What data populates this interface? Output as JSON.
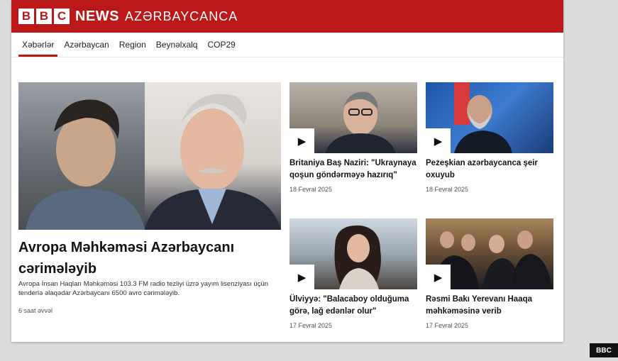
{
  "brand": {
    "blocks": [
      "B",
      "B",
      "C"
    ],
    "news_word": "NEWS",
    "service_word": "AZƏRBAYCANCA",
    "accent_color": "#bb1919"
  },
  "nav": {
    "items": [
      {
        "label": "Xəbərlər",
        "active": true
      },
      {
        "label": "Azərbaycan",
        "active": false
      },
      {
        "label": "Region",
        "active": false
      },
      {
        "label": "Beynəlxalq",
        "active": false
      },
      {
        "label": "COP29",
        "active": false
      }
    ]
  },
  "lead_story": {
    "title": "Avropa Məhkəməsi Azərbaycanı cərimələyib",
    "summary": "Avropa İnsan Haqları Məhkəməsi 103.3 FM radio tezliyi üzrə yayım lisenziyası üçün tenderlə əlaqədar Azərbaycanı 6500 avro cərimələyib.",
    "time": "6 saat əvvəl"
  },
  "cards": [
    {
      "title": "Britaniya Baş Naziri: \"Ukraynaya qoşun göndərməyə hazırıq\"",
      "date": "18 Fevral 2025",
      "icon": "play-icon"
    },
    {
      "title": "Pezeşkian azərbaycanca şeir oxuyub",
      "date": "18 Fevral 2025",
      "icon": "play-icon"
    },
    {
      "title": "Ülviyyə: \"Balacaboy olduğuma görə, lağ edənlər olur\"",
      "date": "17 Fevral 2025",
      "icon": "play-icon"
    },
    {
      "title": "Rəsmi Bakı Yerevanı Haaqa məhkəməsinə verib",
      "date": "17 Fevral 2025",
      "icon": "play-icon"
    }
  ],
  "watermark": "BBC"
}
